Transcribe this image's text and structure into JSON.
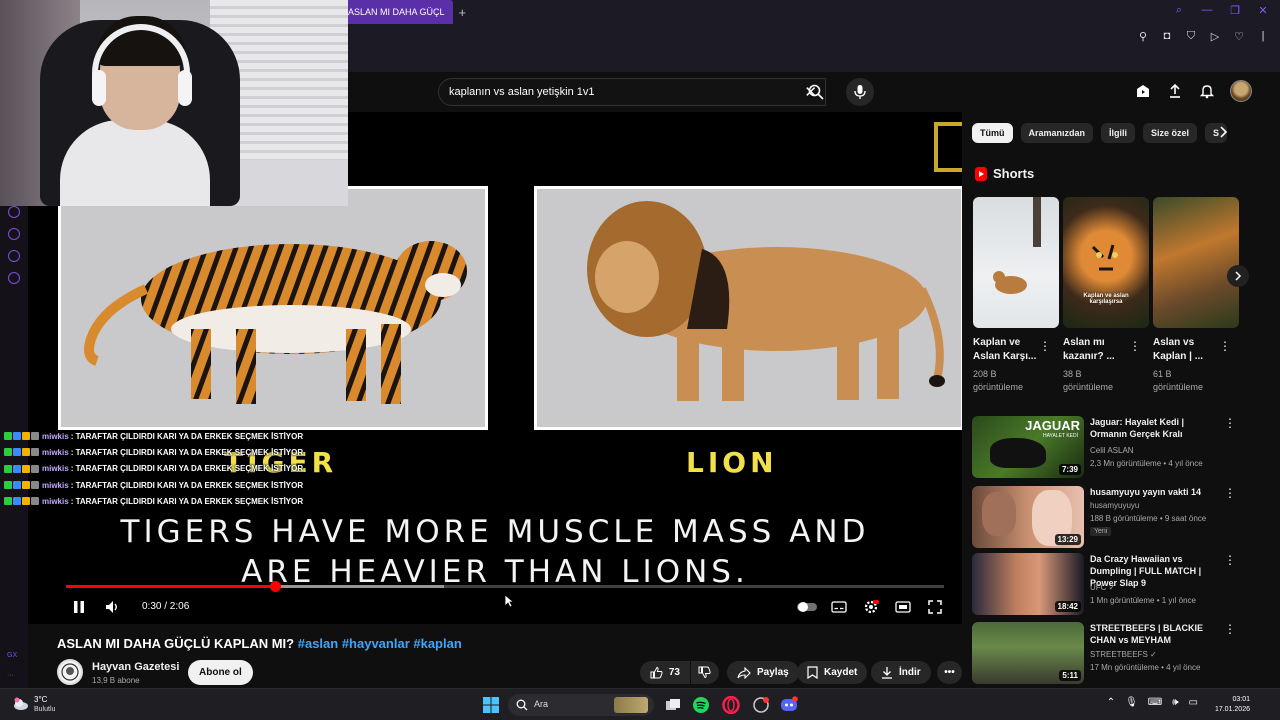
{
  "browser": {
    "tab_title": "ASLAN MI DAHA GÜÇL",
    "new_tab": "+"
  },
  "search": {
    "query": "kaplanın vs aslan yetişkin 1v1"
  },
  "video": {
    "label_left": "TIGER",
    "label_right": "LION",
    "caption_line1": "TIGERS HAVE MORE MUSCLE MASS AND",
    "caption_line2": "ARE HEAVIER THAN LIONS.",
    "time": "0:30 / 2:06",
    "progress": 0.238
  },
  "chat": {
    "lines": [
      {
        "user": "miwkis",
        "text": ": TARAFTAR ÇILDIRDI KARI YA DA ERKEK SEÇMEK İSTİYOR"
      },
      {
        "user": "miwkis",
        "text": ": TARAFTAR ÇILDIRDI KARI YA DA ERKEK SEÇMEK İSTİYOR"
      },
      {
        "user": "miwkis",
        "text": ": TARAFTAR ÇILDIRDI KARI YA DA ERKEK SEÇMEK İSTİYOR"
      },
      {
        "user": "miwkis",
        "text": ": TARAFTAR ÇILDIRDI KARI YA DA ERKEK SEÇMEK İSTİYOR"
      },
      {
        "user": "miwkis",
        "text": ": TARAFTAR ÇILDIRDI KARI YA DA ERKEK SEÇMEK İSTİYOR"
      }
    ]
  },
  "meta": {
    "title_main": "ASLAN MI DAHA GÜÇLÜ KAPLAN MI? ",
    "title_tags": "#aslan #hayvanlar #kaplan",
    "channel": "Hayvan Gazetesi",
    "subs": "13,9 B abone",
    "subscribe": "Abone ol",
    "likes": "73",
    "share": "Paylaş",
    "save": "Kaydet",
    "download": "İndir"
  },
  "chips": [
    "Tümü",
    "Aramanızdan",
    "İlgili",
    "Size özel",
    "S"
  ],
  "shorts": {
    "header": "Shorts",
    "items": [
      {
        "title": "Kaplan ve Aslan Karşı...",
        "views": "208 B görüntüleme"
      },
      {
        "title": "Aslan mı kazanır? ...",
        "views": "38 B görüntüleme",
        "overlay": "Kaplan ve aslan karşılaşırsa"
      },
      {
        "title": "Aslan vs Kaplan | ...",
        "views": "61 B görüntüleme"
      }
    ]
  },
  "recs": [
    {
      "title": "Jaguar: Hayalet Kedi | Ormanın Gerçek Kralı",
      "channel": "Celil ASLAN",
      "meta": "2,3 Mn görüntüleme • 4 yıl önce",
      "duration": "7:39",
      "thumb_text": "JAGUAR",
      "thumb_sub": "HAYALET KEDİ"
    },
    {
      "title": "husamyuyu yayın vakti 14",
      "channel": "husamyuyuyu",
      "meta": "188 B görüntüleme • 9 saat önce",
      "duration": "13:29",
      "badge": "Yeni"
    },
    {
      "title": "Da Crazy Hawaiian vs Dumpling | FULL MATCH | Power Slap 9",
      "channel": "UFC ✓",
      "meta": "1 Mn görüntüleme • 1 yıl önce",
      "duration": "18:42"
    },
    {
      "title": "STREETBEEFS | BLACKIE CHAN vs MEYHAM",
      "channel": "STREETBEEFS ✓",
      "meta": "17 Mn görüntüleme • 4 yıl önce",
      "duration": "5:11"
    }
  ],
  "taskbar": {
    "temp": "3°C",
    "weather": "Bulutlu",
    "search": "Ara",
    "time": "03:01",
    "date": "17.01.2026"
  },
  "rail": {
    "label": "GX"
  },
  "colors": {
    "accent": "#7b4fe0",
    "progress": "#ff0000",
    "link": "#3ea6ff",
    "label_yellow": "#f2e04a"
  }
}
